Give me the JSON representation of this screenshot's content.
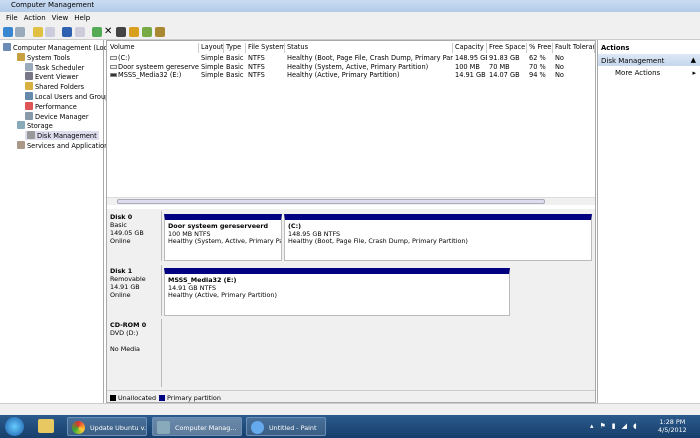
{
  "window": {
    "title": "Computer Management"
  },
  "menu": [
    "File",
    "Action",
    "View",
    "Help"
  ],
  "tree": [
    {
      "label": "Computer Management (Local",
      "level": 0,
      "icon": "computer-icon"
    },
    {
      "label": "System Tools",
      "level": 1,
      "icon": "tools-icon"
    },
    {
      "label": "Task Scheduler",
      "level": 2,
      "icon": "clock-icon"
    },
    {
      "label": "Event Viewer",
      "level": 2,
      "icon": "event-viewer-icon"
    },
    {
      "label": "Shared Folders",
      "level": 2,
      "icon": "shared-folder-icon"
    },
    {
      "label": "Local Users and Groups",
      "level": 2,
      "icon": "users-icon"
    },
    {
      "label": "Performance",
      "level": 2,
      "icon": "performance-icon"
    },
    {
      "label": "Device Manager",
      "level": 2,
      "icon": "device-manager-icon"
    },
    {
      "label": "Storage",
      "level": 1,
      "icon": "storage-icon"
    },
    {
      "label": "Disk Management",
      "level": 2,
      "icon": "disk-icon",
      "selected": true
    },
    {
      "label": "Services and Applications",
      "level": 1,
      "icon": "services-icon"
    }
  ],
  "volumes": {
    "columns": [
      "Volume",
      "Layout",
      "Type",
      "File System",
      "Status",
      "Capacity",
      "Free Space",
      "% Free",
      "Fault Toleran"
    ],
    "rows": [
      [
        "(C:)",
        "Simple",
        "Basic",
        "NTFS",
        "Healthy (Boot, Page File, Crash Dump, Primary Partition)",
        "148.95 GB",
        "91.83 GB",
        "62 %",
        "No"
      ],
      [
        "Door systeem gereserveerd",
        "Simple",
        "Basic",
        "NTFS",
        "Healthy (System, Active, Primary Partition)",
        "100 MB",
        "70 MB",
        "70 %",
        "No"
      ],
      [
        "MSSS_Media32 (E:)",
        "Simple",
        "Basic",
        "NTFS",
        "Healthy (Active, Primary Partition)",
        "14.91 GB",
        "14.07 GB",
        "94 %",
        "No"
      ]
    ]
  },
  "disks": [
    {
      "name": "Disk 0",
      "lines": [
        "Basic",
        "149.05 GB",
        "Online"
      ],
      "partitions": [
        {
          "name": "Door systeem gereserveerd",
          "size": "100 MB NTFS",
          "status": "Healthy (System, Active, Primary Partit"
        },
        {
          "name": "(C:)",
          "size": "148.95 GB NTFS",
          "status": "Healthy (Boot, Page File, Crash Dump, Primary Partition)"
        }
      ]
    },
    {
      "name": "Disk 1",
      "lines": [
        "Removable",
        "14.91 GB",
        "Online"
      ],
      "partitions": [
        {
          "name": "MSSS_Media32  (E:)",
          "size": "14.91 GB NTFS",
          "status": "Healthy (Active, Primary Partition)"
        }
      ]
    },
    {
      "name": "CD-ROM 0",
      "lines": [
        "DVD (D:)",
        "",
        "No Media"
      ],
      "partitions": []
    }
  ],
  "legend": [
    {
      "label": "Unallocated",
      "color": "#000000"
    },
    {
      "label": "Primary partition",
      "color": "#000080"
    }
  ],
  "actions": {
    "header": "Actions",
    "section": "Disk Management",
    "more": "More Actions"
  },
  "taskbar": {
    "tasks": [
      "Update Ubuntu v...",
      "Computer Manag...",
      "Untitled - Paint"
    ],
    "time": "1:28 PM",
    "date": "4/5/2012"
  }
}
